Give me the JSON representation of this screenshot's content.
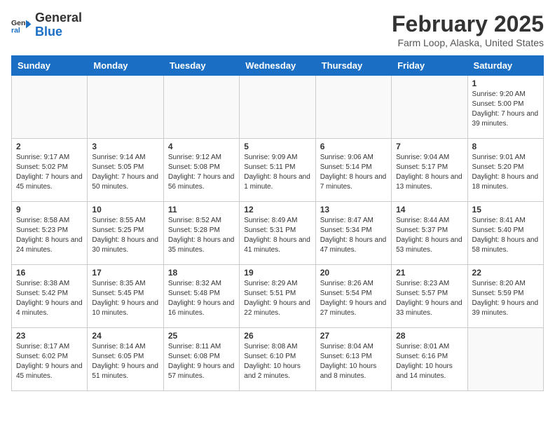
{
  "header": {
    "logo_line1": "General",
    "logo_line2": "Blue",
    "month_title": "February 2025",
    "subtitle": "Farm Loop, Alaska, United States"
  },
  "calendar": {
    "days_of_week": [
      "Sunday",
      "Monday",
      "Tuesday",
      "Wednesday",
      "Thursday",
      "Friday",
      "Saturday"
    ],
    "weeks": [
      [
        {
          "day": "",
          "info": ""
        },
        {
          "day": "",
          "info": ""
        },
        {
          "day": "",
          "info": ""
        },
        {
          "day": "",
          "info": ""
        },
        {
          "day": "",
          "info": ""
        },
        {
          "day": "",
          "info": ""
        },
        {
          "day": "1",
          "info": "Sunrise: 9:20 AM\nSunset: 5:00 PM\nDaylight: 7 hours and 39 minutes."
        }
      ],
      [
        {
          "day": "2",
          "info": "Sunrise: 9:17 AM\nSunset: 5:02 PM\nDaylight: 7 hours and 45 minutes."
        },
        {
          "day": "3",
          "info": "Sunrise: 9:14 AM\nSunset: 5:05 PM\nDaylight: 7 hours and 50 minutes."
        },
        {
          "day": "4",
          "info": "Sunrise: 9:12 AM\nSunset: 5:08 PM\nDaylight: 7 hours and 56 minutes."
        },
        {
          "day": "5",
          "info": "Sunrise: 9:09 AM\nSunset: 5:11 PM\nDaylight: 8 hours and 1 minute."
        },
        {
          "day": "6",
          "info": "Sunrise: 9:06 AM\nSunset: 5:14 PM\nDaylight: 8 hours and 7 minutes."
        },
        {
          "day": "7",
          "info": "Sunrise: 9:04 AM\nSunset: 5:17 PM\nDaylight: 8 hours and 13 minutes."
        },
        {
          "day": "8",
          "info": "Sunrise: 9:01 AM\nSunset: 5:20 PM\nDaylight: 8 hours and 18 minutes."
        }
      ],
      [
        {
          "day": "9",
          "info": "Sunrise: 8:58 AM\nSunset: 5:23 PM\nDaylight: 8 hours and 24 minutes."
        },
        {
          "day": "10",
          "info": "Sunrise: 8:55 AM\nSunset: 5:25 PM\nDaylight: 8 hours and 30 minutes."
        },
        {
          "day": "11",
          "info": "Sunrise: 8:52 AM\nSunset: 5:28 PM\nDaylight: 8 hours and 35 minutes."
        },
        {
          "day": "12",
          "info": "Sunrise: 8:49 AM\nSunset: 5:31 PM\nDaylight: 8 hours and 41 minutes."
        },
        {
          "day": "13",
          "info": "Sunrise: 8:47 AM\nSunset: 5:34 PM\nDaylight: 8 hours and 47 minutes."
        },
        {
          "day": "14",
          "info": "Sunrise: 8:44 AM\nSunset: 5:37 PM\nDaylight: 8 hours and 53 minutes."
        },
        {
          "day": "15",
          "info": "Sunrise: 8:41 AM\nSunset: 5:40 PM\nDaylight: 8 hours and 58 minutes."
        }
      ],
      [
        {
          "day": "16",
          "info": "Sunrise: 8:38 AM\nSunset: 5:42 PM\nDaylight: 9 hours and 4 minutes."
        },
        {
          "day": "17",
          "info": "Sunrise: 8:35 AM\nSunset: 5:45 PM\nDaylight: 9 hours and 10 minutes."
        },
        {
          "day": "18",
          "info": "Sunrise: 8:32 AM\nSunset: 5:48 PM\nDaylight: 9 hours and 16 minutes."
        },
        {
          "day": "19",
          "info": "Sunrise: 8:29 AM\nSunset: 5:51 PM\nDaylight: 9 hours and 22 minutes."
        },
        {
          "day": "20",
          "info": "Sunrise: 8:26 AM\nSunset: 5:54 PM\nDaylight: 9 hours and 27 minutes."
        },
        {
          "day": "21",
          "info": "Sunrise: 8:23 AM\nSunset: 5:57 PM\nDaylight: 9 hours and 33 minutes."
        },
        {
          "day": "22",
          "info": "Sunrise: 8:20 AM\nSunset: 5:59 PM\nDaylight: 9 hours and 39 minutes."
        }
      ],
      [
        {
          "day": "23",
          "info": "Sunrise: 8:17 AM\nSunset: 6:02 PM\nDaylight: 9 hours and 45 minutes."
        },
        {
          "day": "24",
          "info": "Sunrise: 8:14 AM\nSunset: 6:05 PM\nDaylight: 9 hours and 51 minutes."
        },
        {
          "day": "25",
          "info": "Sunrise: 8:11 AM\nSunset: 6:08 PM\nDaylight: 9 hours and 57 minutes."
        },
        {
          "day": "26",
          "info": "Sunrise: 8:08 AM\nSunset: 6:10 PM\nDaylight: 10 hours and 2 minutes."
        },
        {
          "day": "27",
          "info": "Sunrise: 8:04 AM\nSunset: 6:13 PM\nDaylight: 10 hours and 8 minutes."
        },
        {
          "day": "28",
          "info": "Sunrise: 8:01 AM\nSunset: 6:16 PM\nDaylight: 10 hours and 14 minutes."
        },
        {
          "day": "",
          "info": ""
        }
      ]
    ]
  }
}
